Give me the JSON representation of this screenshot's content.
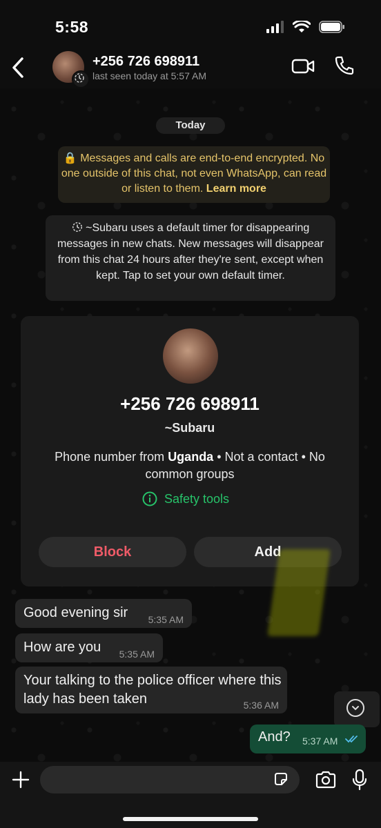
{
  "status_bar": {
    "time": "5:58"
  },
  "header": {
    "contact": "+256 726 698911",
    "last_seen": "last seen today at 5:57 AM"
  },
  "chat": {
    "date_divider": "Today",
    "encryption_notice": "Messages and calls are end-to-end encrypted. No one outside of this chat, not even WhatsApp, can read or listen to them.",
    "encryption_link": "Learn more",
    "timer_notice": "~Subaru uses a default timer for disappearing messages in new chats. New messages will disappear from this chat 24 hours after they're sent, except when kept. Tap to set your own default timer.",
    "contact_card": {
      "number": "+256 726 698911",
      "name": "~Subaru",
      "info_prefix": "Phone number from ",
      "country": "Uganda",
      "info_suffix": " • Not a contact • No common groups",
      "safety_label": "Safety tools",
      "block_label": "Block",
      "add_label": "Add"
    },
    "messages": [
      {
        "text": "Good evening sir",
        "time": "5:35 AM",
        "direction": "in"
      },
      {
        "text": "How are you",
        "time": "5:35 AM",
        "direction": "in"
      },
      {
        "text": "Your talking to the police officer where this lady has been taken",
        "time": "5:36 AM",
        "direction": "in"
      },
      {
        "text": "And?",
        "time": "5:37 AM",
        "direction": "out",
        "status": "read"
      }
    ]
  },
  "composer": {
    "placeholder": ""
  },
  "colors": {
    "accent_green": "#27c36a",
    "block_red": "#ef5b68",
    "outgoing_bubble": "#144d36",
    "encryption_text": "#e5c46a",
    "read_ticks": "#53bdeb"
  }
}
